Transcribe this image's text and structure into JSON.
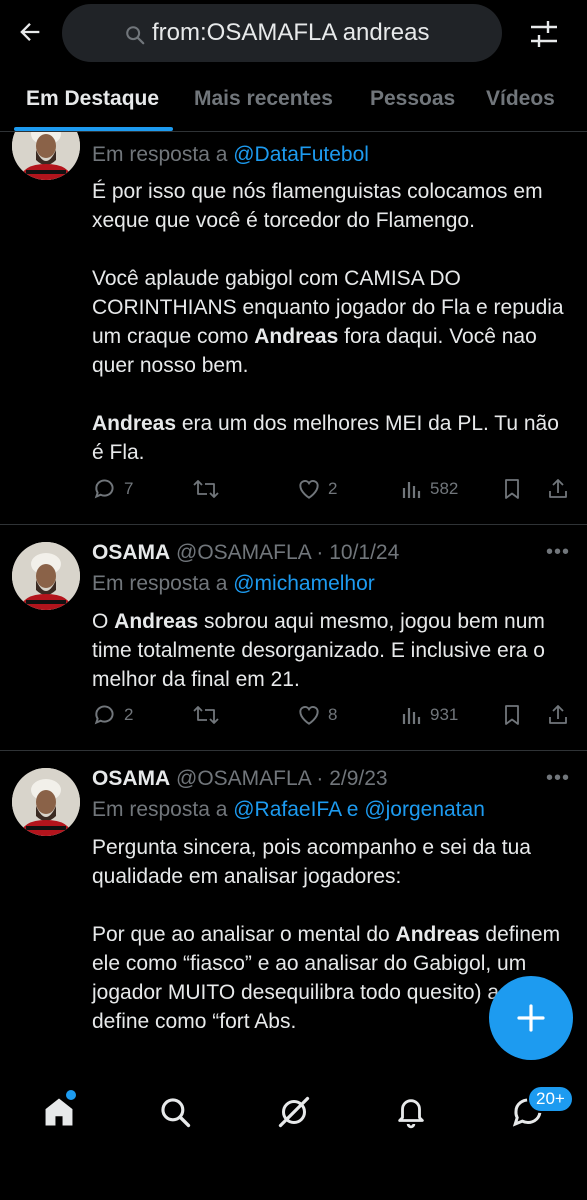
{
  "search": {
    "query": "from:OSAMAFLA andreas"
  },
  "tabs": [
    {
      "label": "Em Destaque"
    },
    {
      "label": "Mais recentes"
    },
    {
      "label": "Pessoas"
    },
    {
      "label": "Vídeos"
    }
  ],
  "tweets": [
    {
      "reply_prefix": "Em resposta a ",
      "mentions": [
        "@DataFutebol"
      ],
      "paragraphs": [
        [
          "É por isso que nós flamenguistas colocamos em xeque que você é torcedor do Flamengo."
        ],
        [
          "Você aplaude gabigol com CAMISA DO CORINTHIANS enquanto jogador do Fla e repudia um craque como ",
          "Andreas",
          " fora daqui. Você nao quer nosso bem."
        ],
        [
          "Andreas",
          " era um dos melhores MEI da PL. Tu não é Fla."
        ]
      ],
      "replies": "7",
      "retweets": "",
      "likes": "2",
      "views": "582"
    },
    {
      "name": "OSAMA",
      "handle": "@OSAMAFLA",
      "date": "10/1/24",
      "reply_prefix": "Em resposta a ",
      "mentions": [
        "@michamelhor"
      ],
      "paragraphs": [
        [
          "O ",
          "Andreas",
          " sobrou aqui mesmo, jogou bem num time totalmente desorganizado. E inclusive era o melhor da final em 21."
        ]
      ],
      "replies": "2",
      "retweets": "",
      "likes": "8",
      "views": "931"
    },
    {
      "name": "OSAMA",
      "handle": "@OSAMAFLA",
      "date": "2/9/23",
      "reply_prefix": "Em resposta a ",
      "mentions": [
        "@RafaeIFA",
        "@jorgenatan"
      ],
      "mention_joiner": " e ",
      "paragraphs": [
        [
          "Pergunta sincera, pois acompanho e sei da tua qualidade em analisar jogadores:"
        ],
        [
          "Por que ao analisar o mental do ",
          "Andreas",
          " definem ele como “fiasco” e ao analisar do Gabigol, um jogador MUITO desequilibra",
          "",
          " todo quesito) a galera define como “fort",
          "",
          " Abs."
        ]
      ]
    }
  ],
  "nav": {
    "items": [
      "home-icon",
      "search-icon",
      "grok-icon",
      "notifications-icon",
      "messages-icon"
    ],
    "messages_badge": "20+"
  },
  "colors": {
    "accent": "#1d9bf0",
    "background": "#000000",
    "text": "#e7e9ea",
    "muted": "#71767b"
  }
}
